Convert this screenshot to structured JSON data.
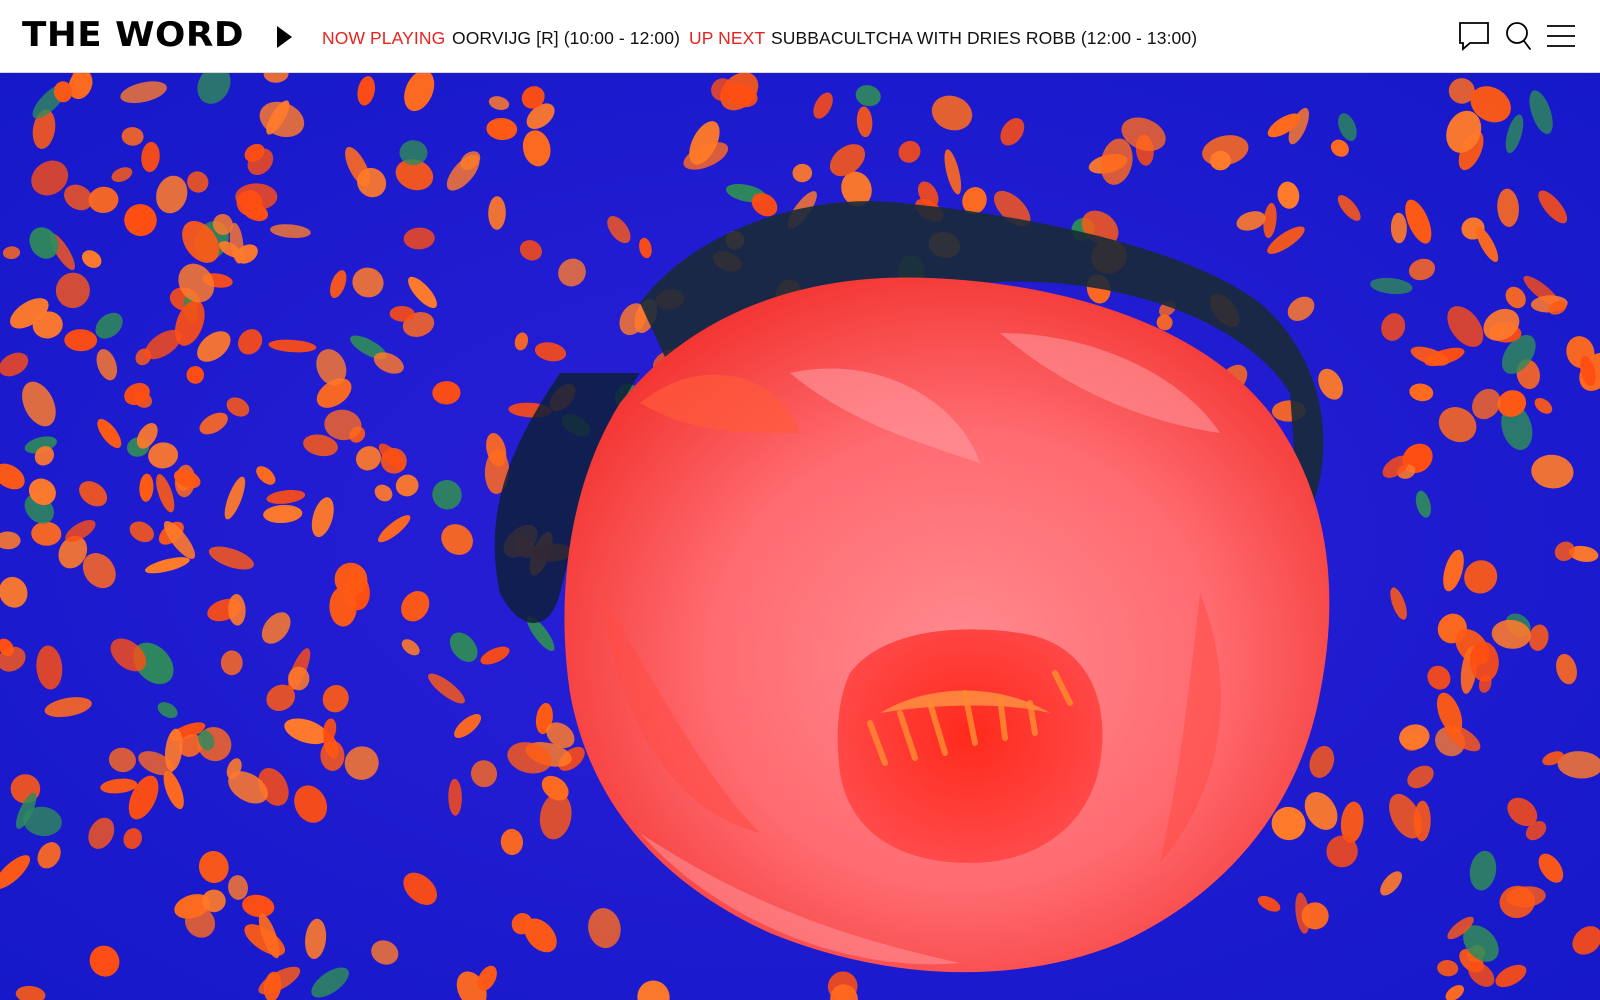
{
  "header": {
    "logo_text": "THE WORD",
    "play_icon": "play-icon",
    "now_playing": {
      "label": "NOW PLAYING",
      "show": "OORVIJG [R] (10:00 - 12:00)"
    },
    "up_next": {
      "label": "UP NEXT",
      "show": "SUBBACULTCHA WITH DRIES ROBB (12:00 - 13:00)"
    },
    "icons": {
      "chat": "chat-bubble-icon",
      "search": "search-icon",
      "menu": "hamburger-menu-icon"
    }
  },
  "hero": {
    "media": "psychedelic-flower-video-frame"
  },
  "colors": {
    "accent": "#e8231f",
    "text": "#111111",
    "hero_blue": "#1c22dc",
    "hero_orange": "#ff5a14",
    "hero_pink": "#ff6f78"
  }
}
